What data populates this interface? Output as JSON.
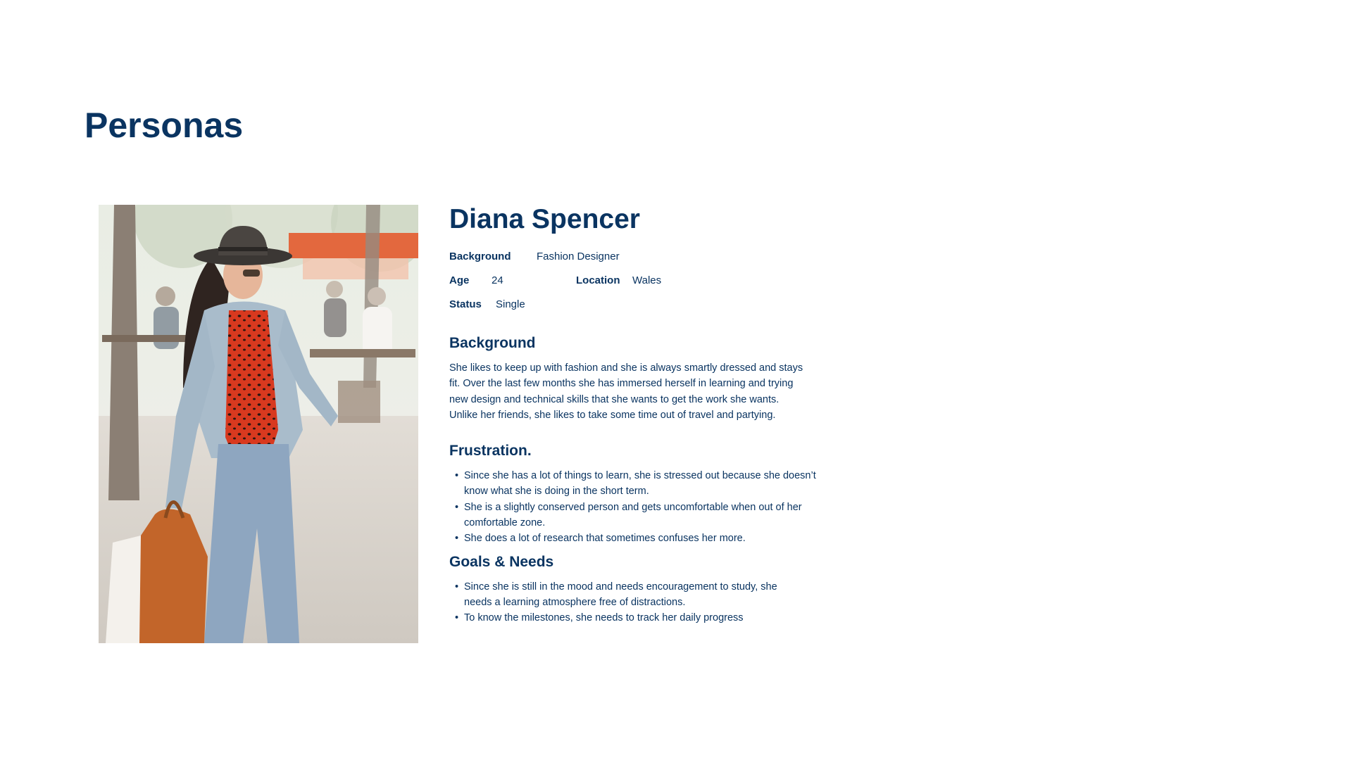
{
  "page": {
    "title": "Personas"
  },
  "persona": {
    "name": "Diana Spencer",
    "facts": {
      "background_label": "Background",
      "background_value": "Fashion Designer",
      "age_label": "Age",
      "age_value": "24",
      "location_label": "Location",
      "location_value": "Wales",
      "status_label": "Status",
      "status_value": "Single"
    },
    "background": {
      "heading": "Background",
      "lines": [
        "She likes to keep up with fashion and she is always smartly dressed and stays",
        "fit. Over the last few months she has immersed herself in learning and trying",
        "new design and technical skills that she wants to get the work she wants.",
        "Unlike her friends, she likes to take some time out of travel and partying."
      ]
    },
    "frustration": {
      "heading": "Frustration.",
      "items": [
        [
          "Since she has a lot of things to learn, she is stressed  out because she doesn’t",
          "know what she is doing in the short term."
        ],
        [
          "She is a slightly conserved person and gets uncomfortable when out of her",
          "comfortable zone."
        ],
        [
          "She does a lot of research that sometimes confuses her more."
        ]
      ]
    },
    "goals": {
      "heading": "Goals & Needs",
      "items": [
        [
          "Since she is still in the mood and needs encouragement to study, she",
          "needs a learning atmosphere free of distractions."
        ],
        [
          "To know the milestones, she needs to track her daily progress"
        ]
      ]
    }
  },
  "colors": {
    "primary_navy": "#0a3461",
    "background": "#ffffff"
  },
  "bullet_glyph": "•"
}
